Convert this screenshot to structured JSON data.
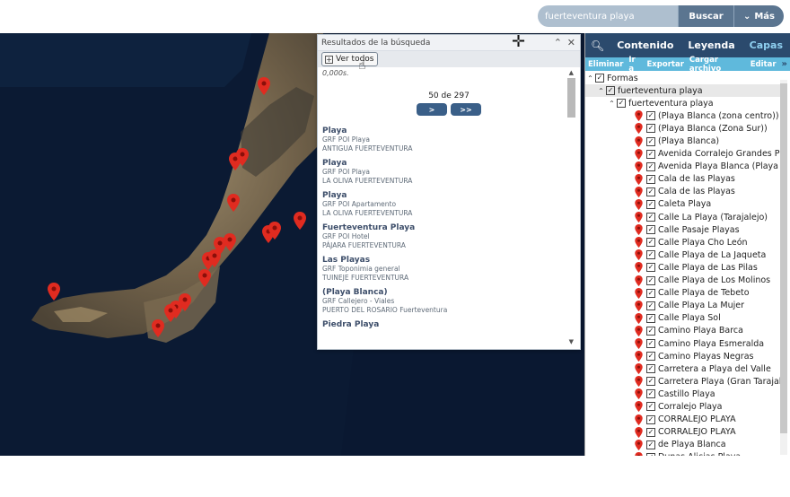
{
  "search": {
    "value": "fuerteventura playa",
    "button": "Buscar",
    "more": "Más"
  },
  "popup": {
    "title": "Resultados de la búsqueda",
    "ver_todos": "Ver todos",
    "distance": "0,000s.",
    "pager": "50 de 297",
    "next": ">",
    "last": ">>",
    "results": [
      {
        "name": "Playa",
        "type": "GRF POI Playa",
        "place": "ANTIGUA FUERTEVENTURA"
      },
      {
        "name": "Playa",
        "type": "GRF POI Playa",
        "place": "LA OLIVA FUERTEVENTURA"
      },
      {
        "name": "Playa",
        "type": "GRF POI Apartamento",
        "place": "LA OLIVA FUERTEVENTURA"
      },
      {
        "name": "Fuerteventura Playa",
        "type": "GRF POI Hotel",
        "place": "PÁJARA FUERTEVENTURA"
      },
      {
        "name": "Las Playas",
        "type": "GRF Toponimia general",
        "place": "TUINEJE FUERTEVENTURA"
      },
      {
        "name": "(Playa Blanca)",
        "type": "GRF Callejero - Viales",
        "place": "PUERTO DEL ROSARIO Fuerteventura"
      },
      {
        "name": "Piedra Playa",
        "type": "",
        "place": ""
      }
    ]
  },
  "panel": {
    "tabs": [
      "Contenido",
      "Leyenda",
      "Capas"
    ],
    "actions": [
      "Eliminar",
      "Ir a",
      "Exportar",
      "Cargar archivo",
      "Editar"
    ],
    "more": "»",
    "root": "Formas",
    "group": "fuerteventura playa",
    "subgroup": "fuerteventura playa",
    "items": [
      "(Playa Blanca (zona centro))",
      "(Playa Blanca (Zona Sur))",
      "(Playa Blanca)",
      "Avenida Corralejo Grandes Pl",
      "Avenida Playa Blanca (Playa",
      "Cala de las Playas",
      "Cala de las Playas",
      "Caleta Playa",
      "Calle La Playa (Tarajalejo)",
      "Calle Pasaje Playas",
      "Calle Playa Cho León",
      "Calle Playa de La Jaqueta",
      "Calle Playa de Las Pilas",
      "Calle Playa de Los Molinos",
      "Calle Playa de Tebeto",
      "Calle Playa La Mujer",
      "Calle Playa Sol",
      "Camino Playa Barca",
      "Camino Playa Esmeralda",
      "Camino Playas Negras",
      "Carretera a Playa del Valle",
      "Carretera Playa (Gran Tarajal",
      "Castillo Playa",
      "Corralejo Playa",
      "CORRALEJO PLAYA",
      "CORRALEJO PLAYA",
      "de Playa Blanca",
      "Dunas Alicias Playa"
    ]
  },
  "colors": {
    "header": "#2b4a6d",
    "accent": "#5fb9dc",
    "pin": "#e02b20"
  },
  "icons": [
    "search-icon",
    "chevron-down-icon",
    "move-icon",
    "close-icon",
    "collapse-icon",
    "plus-icon",
    "hand-cursor-icon",
    "map-pin-icon",
    "checkbox-icon"
  ]
}
